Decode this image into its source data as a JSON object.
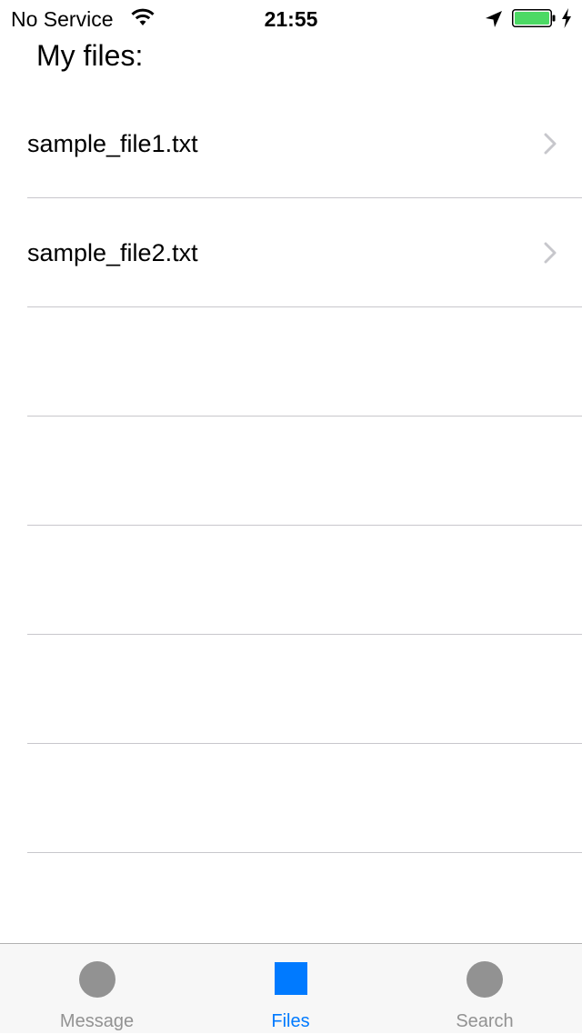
{
  "status_bar": {
    "carrier": "No Service",
    "time": "21:55",
    "battery_level": 1.0,
    "battery_color": "#4cd964"
  },
  "page": {
    "title": "My files:"
  },
  "files": [
    {
      "name": "sample_file1.txt"
    },
    {
      "name": "sample_file2.txt"
    }
  ],
  "tab_bar": {
    "tabs": [
      {
        "label": "Message",
        "icon": "circle-icon",
        "active": false
      },
      {
        "label": "Files",
        "icon": "square-icon",
        "active": true
      },
      {
        "label": "Search",
        "icon": "circle-icon",
        "active": false
      }
    ],
    "active_color": "#007aff",
    "inactive_color": "#929292"
  }
}
